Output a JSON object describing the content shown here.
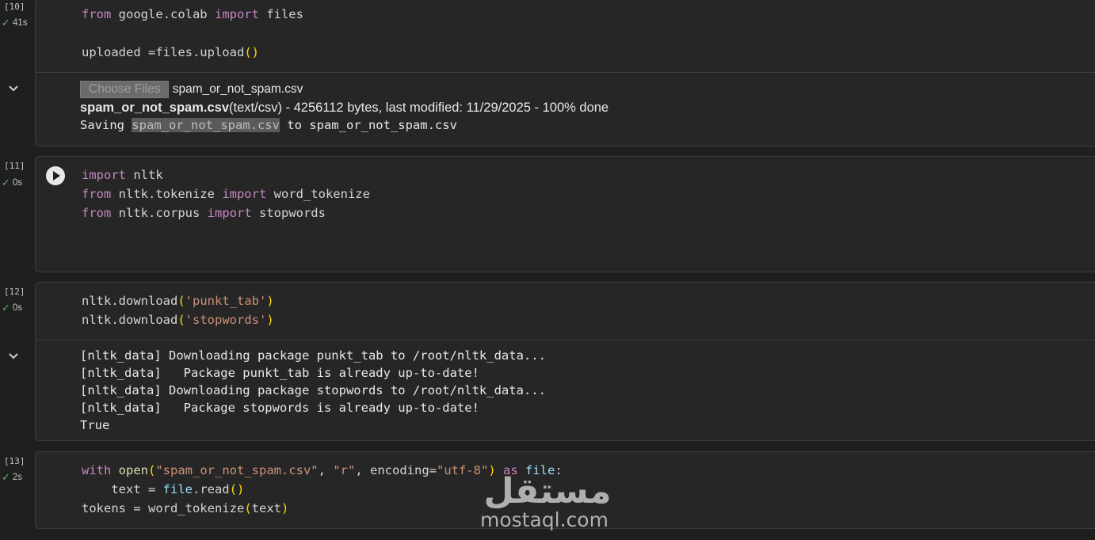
{
  "cells": [
    {
      "exec_count": "[10]",
      "time": "41s",
      "code": {
        "l1": {
          "a": "from",
          "b": " google.colab ",
          "c": "import",
          "d": " files"
        },
        "l2": {
          "a": "uploaded =files.upload",
          "b": "()"
        }
      },
      "output": {
        "choose_button": "Choose Files",
        "chosen_file": "spam_or_not_spam.csv",
        "upload_name": "spam_or_not_spam.csv",
        "upload_info": "(text/csv) - 4256112 bytes, last modified: 11/29/2025 - 100% done",
        "saving_prefix": "Saving ",
        "saving_link": "spam_or_not_spam.csv",
        "saving_suffix": " to spam_or_not_spam.csv"
      }
    },
    {
      "exec_count": "[11]",
      "time": "0s",
      "code": {
        "l1": {
          "a": "import",
          "b": " nltk"
        },
        "l2": {
          "a": "from",
          "b": " nltk.tokenize ",
          "c": "import",
          "d": " word_tokenize"
        },
        "l3": {
          "a": "from",
          "b": " nltk.corpus ",
          "c": "import",
          "d": " stopwords"
        }
      }
    },
    {
      "exec_count": "[12]",
      "time": "0s",
      "code": {
        "l1": {
          "a": "nltk.download",
          "b": "(",
          "c": "'punkt_tab'",
          "d": ")"
        },
        "l2": {
          "a": "nltk.download",
          "b": "(",
          "c": "'stopwords'",
          "d": ")"
        }
      },
      "output_lines": [
        "[nltk_data] Downloading package punkt_tab to /root/nltk_data...",
        "[nltk_data]   Package punkt_tab is already up-to-date!",
        "[nltk_data] Downloading package stopwords to /root/nltk_data...",
        "[nltk_data]   Package stopwords is already up-to-date!",
        "True"
      ]
    },
    {
      "exec_count": "[13]",
      "time": "2s",
      "code": {
        "l1": {
          "a": "with",
          "b": " open",
          "c": "(",
          "d": "\"spam_or_not_spam.csv\"",
          "e": ", ",
          "f": "\"r\"",
          "g": ", encoding=",
          "h": "\"utf-8\"",
          "i": ")",
          "j": " as ",
          "k": "file",
          ":": ":"
        },
        "l2": {
          "a": "    text = ",
          "b": "file",
          ".": ".read",
          "p": "()"
        },
        "l3": {
          "a": "tokens = word_tokenize",
          "b": "(",
          "c": "text",
          "d": ")"
        }
      }
    }
  ],
  "watermark": {
    "arabic": "مستقل",
    "latin": "mostaql.com"
  },
  "colors": {
    "background": "#1f1f1f",
    "keyword": "#c586c0",
    "string": "#ce9178",
    "bracket": "#ffd700",
    "success": "#5cb85c"
  }
}
